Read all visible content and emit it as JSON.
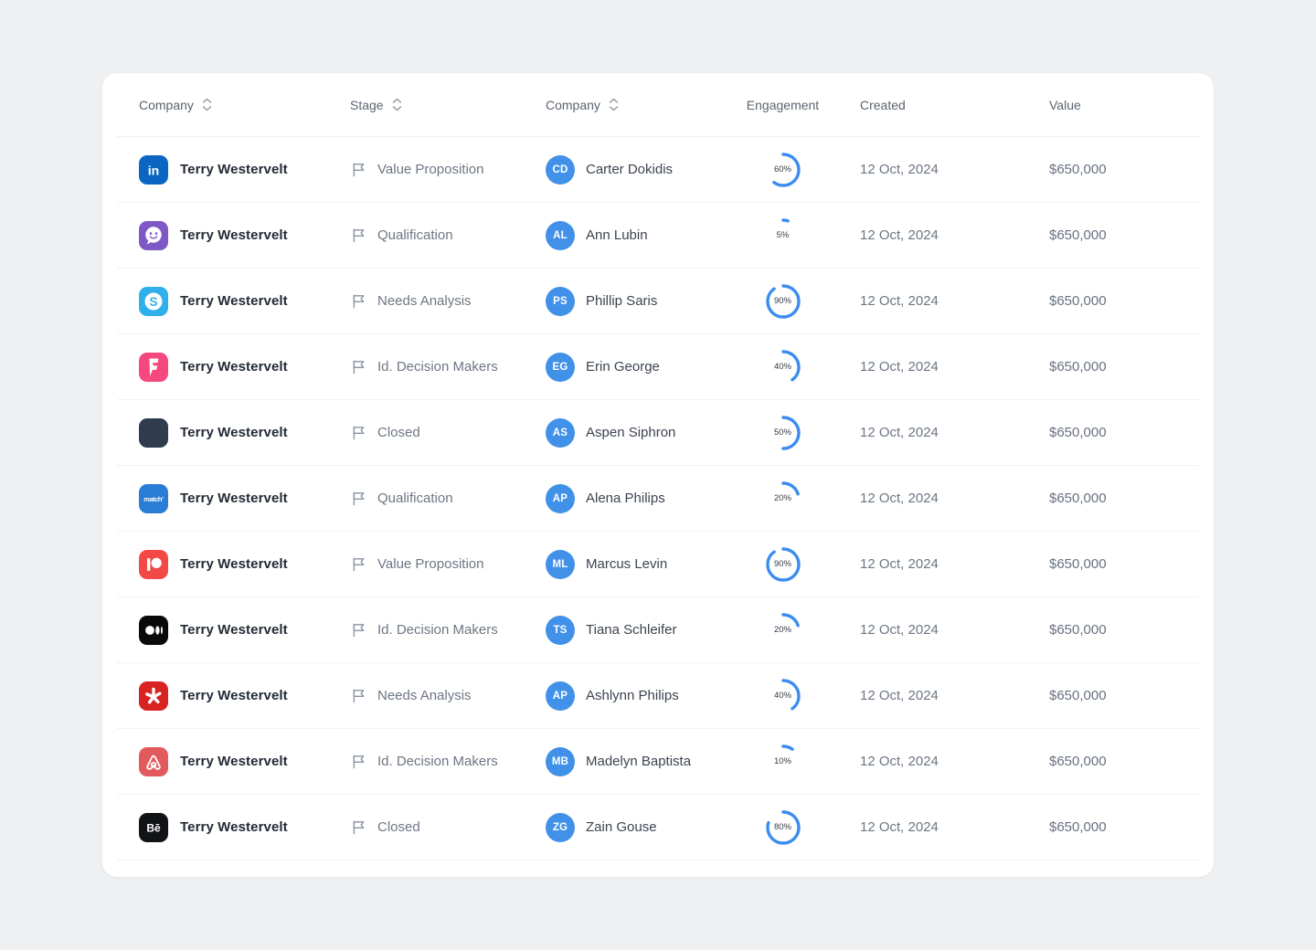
{
  "table": {
    "headers": [
      {
        "label": "Company",
        "sortable": true
      },
      {
        "label": "Stage",
        "sortable": true
      },
      {
        "label": "Company",
        "sortable": true
      },
      {
        "label": "Engagement",
        "sortable": false
      },
      {
        "label": "Created",
        "sortable": false
      },
      {
        "label": "Value",
        "sortable": false
      }
    ],
    "rows": [
      {
        "logo": "linkedin",
        "company": "Terry Westervelt",
        "stage": "Value Proposition",
        "initials": "CD",
        "contact": "Carter Dokidis",
        "engagement": 60,
        "engagement_label": "60%",
        "created": "12 Oct, 2024",
        "value": "$650,000"
      },
      {
        "logo": "chat",
        "company": "Terry Westervelt",
        "stage": "Qualification",
        "initials": "AL",
        "contact": "Ann Lubin",
        "engagement": 5,
        "engagement_label": "5%",
        "created": "12 Oct, 2024",
        "value": "$650,000"
      },
      {
        "logo": "skype",
        "company": "Terry Westervelt",
        "stage": "Needs Analysis",
        "initials": "PS",
        "contact": "Phillip Saris",
        "engagement": 90,
        "engagement_label": "90%",
        "created": "12 Oct, 2024",
        "value": "$650,000"
      },
      {
        "logo": "foursquare",
        "company": "Terry Westervelt",
        "stage": "Id. Decision Makers",
        "initials": "EG",
        "contact": "Erin George",
        "engagement": 40,
        "engagement_label": "40%",
        "created": "12 Oct, 2024",
        "value": "$650,000"
      },
      {
        "logo": "dark",
        "company": "Terry Westervelt",
        "stage": "Closed",
        "initials": "AS",
        "contact": "Aspen Siphron",
        "engagement": 50,
        "engagement_label": "50%",
        "created": "12 Oct, 2024",
        "value": "$650,000"
      },
      {
        "logo": "match",
        "company": "Terry Westervelt",
        "stage": "Qualification",
        "initials": "AP",
        "contact": "Alena Philips",
        "engagement": 20,
        "engagement_label": "20%",
        "created": "12 Oct, 2024",
        "value": "$650,000"
      },
      {
        "logo": "patreon",
        "company": "Terry Westervelt",
        "stage": "Value Proposition",
        "initials": "ML",
        "contact": "Marcus Levin",
        "engagement": 90,
        "engagement_label": "90%",
        "created": "12 Oct, 2024",
        "value": "$650,000"
      },
      {
        "logo": "medium",
        "company": "Terry Westervelt",
        "stage": "Id. Decision Makers",
        "initials": "TS",
        "contact": "Tiana Schleifer",
        "engagement": 20,
        "engagement_label": "20%",
        "created": "12 Oct, 2024",
        "value": "$650,000"
      },
      {
        "logo": "yelp",
        "company": "Terry Westervelt",
        "stage": "Needs Analysis",
        "initials": "AP",
        "contact": "Ashlynn Philips",
        "engagement": 40,
        "engagement_label": "40%",
        "created": "12 Oct, 2024",
        "value": "$650,000"
      },
      {
        "logo": "airbnb",
        "company": "Terry Westervelt",
        "stage": "Id. Decision Makers",
        "initials": "MB",
        "contact": "Madelyn Baptista",
        "engagement": 10,
        "engagement_label": "10%",
        "created": "12 Oct, 2024",
        "value": "$650,000"
      },
      {
        "logo": "behance",
        "company": "Terry Westervelt",
        "stage": "Closed",
        "initials": "ZG",
        "contact": "Zain Gouse",
        "engagement": 80,
        "engagement_label": "80%",
        "created": "12 Oct, 2024",
        "value": "$650,000"
      }
    ]
  },
  "logos": {
    "linkedin": {
      "bg": "#0a66c2"
    },
    "chat": {
      "bg": "#7d58c6"
    },
    "skype": {
      "bg": "#2fb0ea"
    },
    "foursquare": {
      "bg": "#f5487f"
    },
    "dark": {
      "bg": "#2e3c4e"
    },
    "match": {
      "bg": "#2a7cd4"
    },
    "patreon": {
      "bg": "#f24946"
    },
    "medium": {
      "bg": "#0a0a0a"
    },
    "yelp": {
      "bg": "#d92323"
    },
    "airbnb": {
      "bg": "#e25a5e"
    },
    "behance": {
      "bg": "#121316"
    }
  },
  "colors": {
    "accent_progress": "#3b8cf0",
    "avatar_bg": "#4191e8",
    "page_bg": "#eef0f2",
    "card_bg": "#ffffff"
  }
}
